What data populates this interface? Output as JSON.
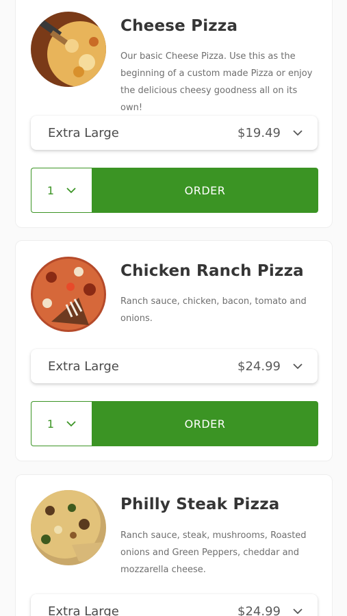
{
  "menu": {
    "items": [
      {
        "name": "Cheese Pizza",
        "description": "Our basic Cheese Pizza. Use this as the beginning of a custom made Pizza or enjoy the delicious cheesy goodness all on its own!",
        "size": "Extra Large",
        "price": "$19.49",
        "quantity": "1",
        "order_label": "ORDER",
        "image_icon": "cheese-pizza-photo"
      },
      {
        "name": "Chicken Ranch Pizza",
        "description": "Ranch sauce, chicken, bacon, tomato and onions.",
        "size": "Extra Large",
        "price": "$24.99",
        "quantity": "1",
        "order_label": "ORDER",
        "image_icon": "chicken-ranch-pizza-photo"
      },
      {
        "name": "Philly Steak Pizza",
        "description": "Ranch sauce, steak, mushrooms, Roasted onions and Green Peppers, cheddar and mozzarella cheese.",
        "size": "Extra Large",
        "price": "$24.99",
        "image_icon": "philly-steak-pizza-photo"
      }
    ]
  },
  "colors": {
    "accent_green": "#3b9424",
    "card_background": "#ffffff",
    "page_background": "#fafafa"
  }
}
